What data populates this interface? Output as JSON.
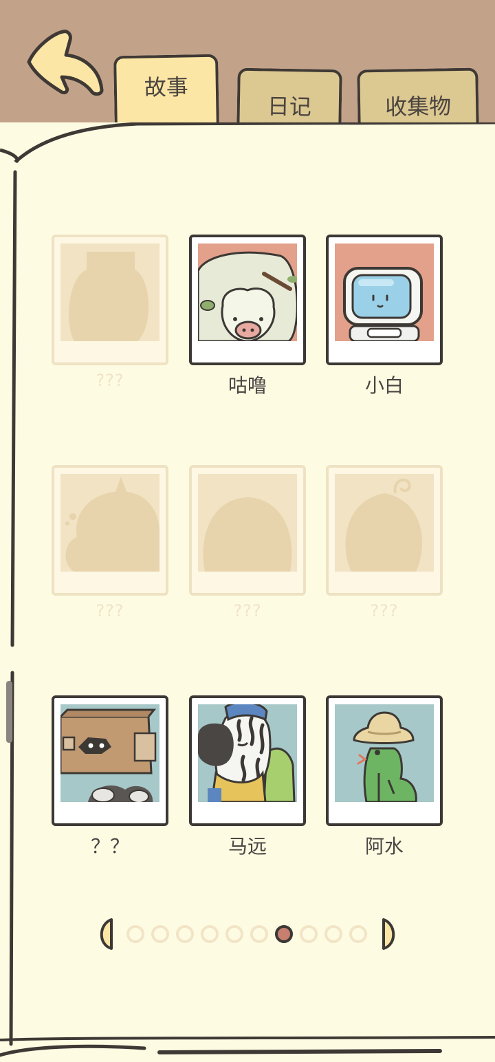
{
  "tabs": [
    {
      "label": "故事",
      "active": true
    },
    {
      "label": "日记",
      "active": false
    },
    {
      "label": "收集物",
      "active": false
    }
  ],
  "characters": [
    {
      "name": "???",
      "locked": true,
      "icon": "silhouette-bear-icon"
    },
    {
      "name": "咕噜",
      "locked": false,
      "icon": "sheep-pig-icon"
    },
    {
      "name": "小白",
      "locked": false,
      "icon": "robot-tv-icon"
    },
    {
      "name": "???",
      "locked": true,
      "icon": "silhouette-bush-icon"
    },
    {
      "name": "???",
      "locked": true,
      "icon": "silhouette-round-icon"
    },
    {
      "name": "???",
      "locked": true,
      "icon": "silhouette-sprout-icon"
    },
    {
      "name": "？？",
      "locked": false,
      "icon": "box-head-icon"
    },
    {
      "name": "马远",
      "locked": false,
      "icon": "zebra-icon"
    },
    {
      "name": "阿水",
      "locked": false,
      "icon": "frog-hat-icon"
    }
  ],
  "pagination": {
    "total_pages": 10,
    "current_page": 7
  },
  "colors": {
    "background": "#c2a38a",
    "page": "#fefbe3",
    "active_tab": "#fbe6a6",
    "inactive_tab": "#dcc891",
    "outline": "#3c3834",
    "current_dot": "#c77f6f"
  }
}
